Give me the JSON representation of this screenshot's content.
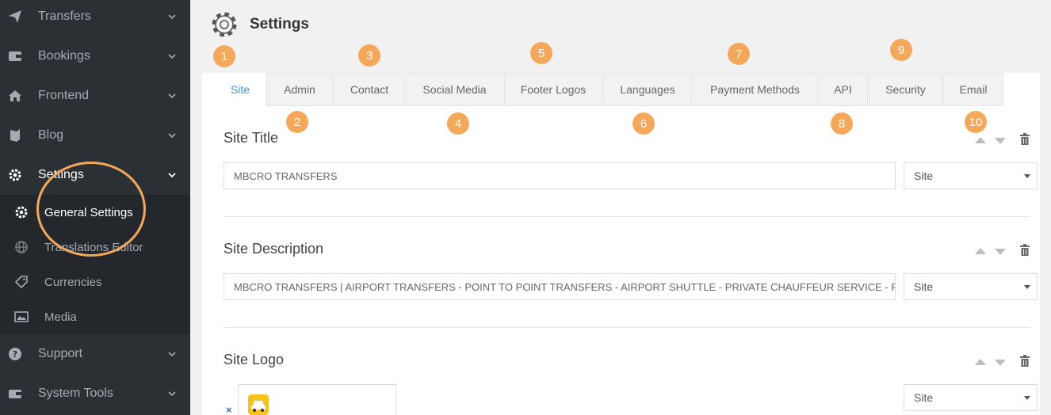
{
  "sidebar": {
    "items": [
      {
        "label": "Transfers",
        "icon": "paper-plane-icon"
      },
      {
        "label": "Bookings",
        "icon": "wallet-icon"
      },
      {
        "label": "Frontend",
        "icon": "home-icon"
      },
      {
        "label": "Blog",
        "icon": "book-icon"
      },
      {
        "label": "Settings",
        "icon": "gear-icon"
      },
      {
        "label": "Support",
        "icon": "question-icon"
      },
      {
        "label": "System Tools",
        "icon": "toolbox-icon"
      }
    ],
    "submenu": [
      {
        "label": "General Settings",
        "icon": "gear-icon"
      },
      {
        "label": "Translations Editor",
        "icon": "globe-icon"
      },
      {
        "label": "Currencies",
        "icon": "tag-icon"
      },
      {
        "label": "Media",
        "icon": "image-icon"
      }
    ]
  },
  "header": {
    "title": "Settings"
  },
  "tabs": [
    "Site",
    "Admin",
    "Contact",
    "Social Media",
    "Footer Logos",
    "Languages",
    "Payment Methods",
    "API",
    "Security",
    "Email"
  ],
  "badges": [
    "1",
    "2",
    "3",
    "4",
    "5",
    "6",
    "7",
    "8",
    "9",
    "10"
  ],
  "fields": {
    "site_title": {
      "label": "Site Title",
      "value": "MBCRO TRANSFERS",
      "scope": "Site"
    },
    "site_description": {
      "label": "Site Description",
      "value": "MBCRO TRANSFERS  | AIRPORT TRANSFERS  - POINT TO POINT TRANSFERS - AIRPORT SHUTTLE - PRIVATE CHAUFFEUR SERVICE - PRIVATE",
      "scope": "Site"
    },
    "site_logo": {
      "label": "Site Logo",
      "remove": "×",
      "scope": "Site"
    }
  },
  "colors": {
    "accent": "#f6a85a",
    "active_tab": "#3a9ad9",
    "sidebar_bg": "#2b3035"
  }
}
